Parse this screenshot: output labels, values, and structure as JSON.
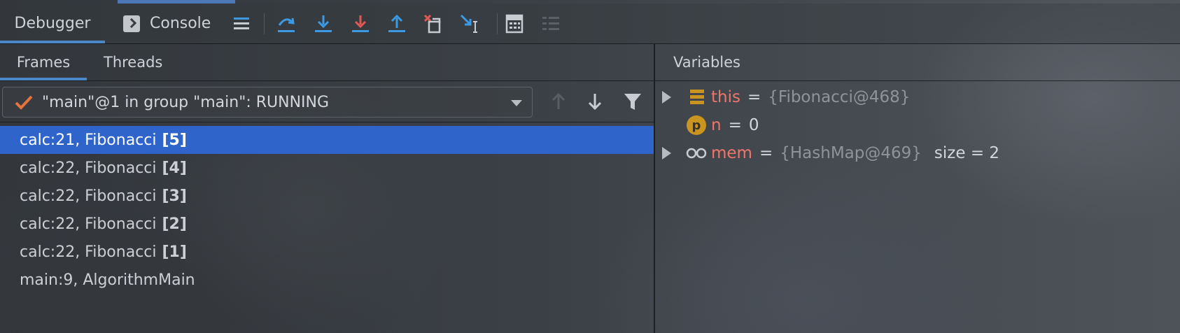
{
  "toolbar": {
    "tab_debugger": "Debugger",
    "tab_console": "Console",
    "buttons": [
      {
        "name": "show-execution-point",
        "icon": "list-icon"
      },
      {
        "name": "step-over",
        "icon": "step-over-icon"
      },
      {
        "name": "step-into",
        "icon": "step-into-icon"
      },
      {
        "name": "force-step-into",
        "icon": "force-step-into-icon"
      },
      {
        "name": "step-out",
        "icon": "step-out-icon"
      },
      {
        "name": "drop-frame",
        "icon": "drop-frame-icon"
      },
      {
        "name": "run-to-cursor",
        "icon": "run-to-cursor-icon"
      },
      {
        "name": "evaluate-expression",
        "icon": "calculator-icon"
      },
      {
        "name": "trace-current-stream",
        "icon": "trace-icon"
      }
    ]
  },
  "frames_panel": {
    "tab_frames": "Frames",
    "tab_threads": "Threads",
    "thread_selector": "\"main\"@1 in group \"main\": RUNNING",
    "frames": [
      {
        "label": "calc:21, Fibonacci",
        "num": "[5]"
      },
      {
        "label": "calc:22, Fibonacci",
        "num": "[4]"
      },
      {
        "label": "calc:22, Fibonacci",
        "num": "[3]"
      },
      {
        "label": "calc:22, Fibonacci",
        "num": "[2]"
      },
      {
        "label": "calc:22, Fibonacci",
        "num": "[1]"
      },
      {
        "label": "main:9, AlgorithmMain",
        "num": ""
      }
    ]
  },
  "variables_panel": {
    "title": "Variables",
    "vars": [
      {
        "name": "this",
        "eq": "=",
        "value": "{Fibonacci@468}",
        "extra": "",
        "icon": "field-icon"
      },
      {
        "name": "n",
        "eq": "=",
        "value": "0",
        "extra": "",
        "icon": "parameter-icon",
        "icon_letter": "p"
      },
      {
        "name": "mem",
        "eq": "=",
        "value": "{HashMap@469}",
        "extra": "size = 2",
        "icon": "watch-glasses-icon"
      }
    ]
  },
  "colors": {
    "accent_blue": "#4a88c7",
    "selection": "#2f65ca",
    "var_name": "#f07669",
    "icon_blue": "#3d9ae2",
    "icon_red": "#e15952",
    "param_badge": "#c9951f"
  }
}
